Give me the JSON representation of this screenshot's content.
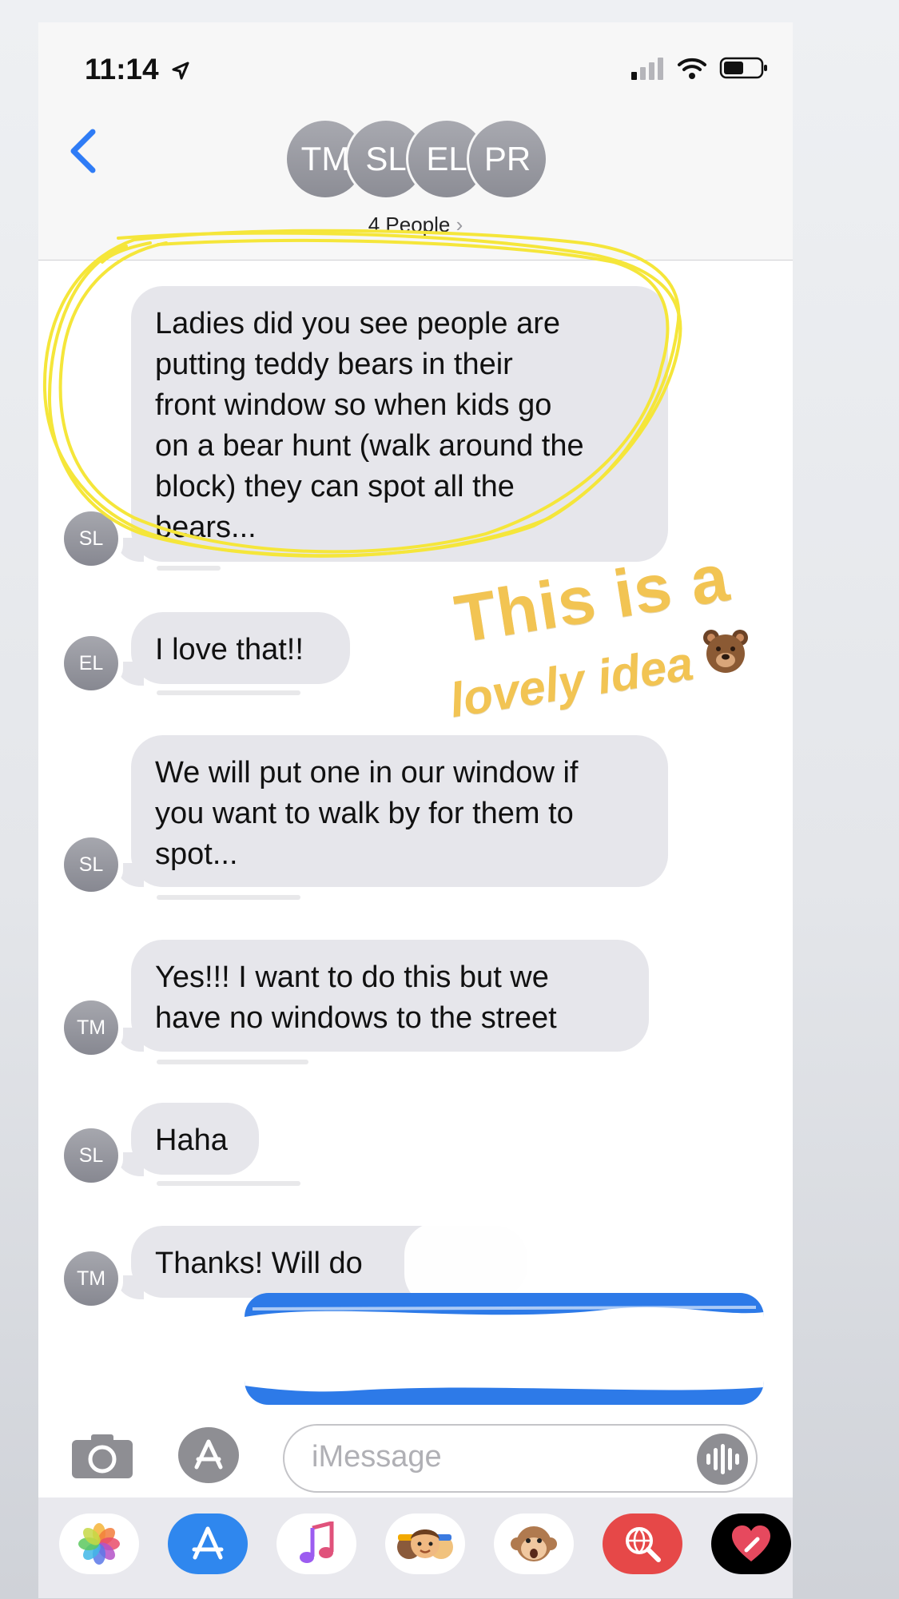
{
  "status_bar": {
    "time": "11:14"
  },
  "header": {
    "participants": [
      "TM",
      "SL",
      "EL",
      "PR"
    ],
    "people_label": "4 People",
    "people_chevron": "›"
  },
  "messages": [
    {
      "sender": "SL",
      "lines": [
        "Ladies did you see people are",
        "putting teddy bears in their",
        "front window so when kids go",
        "on a bear hunt (walk around the",
        "block) they can spot all the",
        "bears..."
      ]
    },
    {
      "sender": "EL",
      "lines": [
        "I love that!!"
      ]
    },
    {
      "sender": "SL",
      "lines": [
        "We will put one in our window if",
        "you want to walk by for them to",
        "spot..."
      ]
    },
    {
      "sender": "TM",
      "lines": [
        "Yes!!! I want to do this but we",
        "have no windows to the street"
      ]
    },
    {
      "sender": "SL",
      "lines": [
        "Haha"
      ]
    },
    {
      "sender": "TM",
      "lines": [
        "Thanks! Will do"
      ]
    }
  ],
  "sticker": {
    "line1": "This is a",
    "line2": "lovely idea",
    "color": "#f2c453",
    "emoji_icon": "bear-face-icon"
  },
  "highlight_color": "#f5e63a",
  "input": {
    "placeholder": "iMessage"
  },
  "colors": {
    "accent": "#2f7cf6",
    "incoming_bubble": "#e6e6eb",
    "outgoing_bubble": "#2d7ae8"
  },
  "app_tray": [
    "photos-icon",
    "app-store-icon",
    "music-icon",
    "memoji-icon",
    "animoji-monkey-icon",
    "web-search-icon",
    "digital-touch-icon"
  ]
}
